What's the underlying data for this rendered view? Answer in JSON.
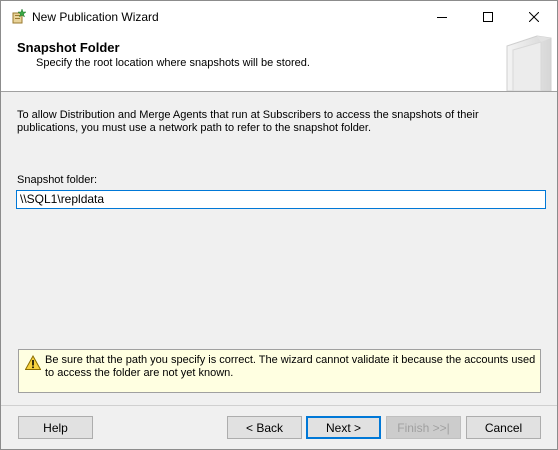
{
  "window": {
    "title": "New Publication Wizard",
    "icon": "publication-wizard-icon",
    "controls": {
      "minimize": "minimize-icon",
      "maximize": "maximize-icon",
      "close": "close-icon"
    }
  },
  "header": {
    "title": "Snapshot Folder",
    "subtitle": "Specify the root location where snapshots will be stored."
  },
  "body": {
    "description": "To allow Distribution and Merge Agents that run at Subscribers to access the snapshots of their publications, you must use a network path to refer to the snapshot folder.",
    "snapshot_folder_label": "Snapshot folder:",
    "snapshot_folder_value": "\\\\SQL1\\repldata"
  },
  "warning": {
    "icon": "warning-icon",
    "text": "Be sure that the path you specify is correct. The wizard cannot validate it because the accounts used to access the folder are not yet known."
  },
  "footer": {
    "help": "Help",
    "back": "< Back",
    "next": "Next >",
    "finish": "Finish >>|",
    "cancel": "Cancel"
  },
  "colors": {
    "accent": "#0078d7",
    "warning_bg": "#ffffe1",
    "dialog_bg": "#f0f0f0"
  }
}
